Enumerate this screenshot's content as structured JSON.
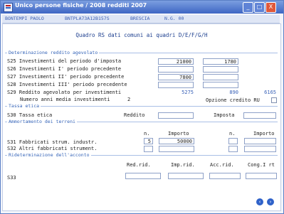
{
  "window": {
    "title": "Unico persone fisiche / 2008 redditi 2007",
    "minimize_label": "_",
    "maximize_label": "□",
    "close_label": "X"
  },
  "infobar": {
    "name": "BONTEMPI PAOLO",
    "code": "BNTPLA73A12B157S",
    "city": "BRESCIA",
    "ref": "N.G. 00"
  },
  "panel": {
    "title": "Quadro RS dati comuni ai quadri D/E/F/G/H"
  },
  "section_reddito": {
    "legend": "Determinazione reddito agevolato",
    "rows": [
      {
        "label": "S25 Investimenti del periodo d'imposta",
        "v1": "21000",
        "v2": "1780"
      },
      {
        "label": "S26 Investimenti I' periodo precedente",
        "v1": "",
        "v2": ""
      },
      {
        "label": "S27 Investimenti II' periodo precedente",
        "v1": "7800",
        "v2": ""
      },
      {
        "label": "S28 Investimenti III' periodo precedente",
        "v1": "",
        "v2": ""
      },
      {
        "label": "S29 Reddito agevolato per investimenti",
        "v1": "5275",
        "v2": "890",
        "v3": "6165"
      }
    ],
    "media_label": "Numero anni media investimenti",
    "media_value": "2",
    "opzione_label": "Opzione credito RU"
  },
  "section_tassa": {
    "legend": "Tassa etica",
    "row_label": "S30 Tassa etica",
    "reddito_label": "Reddito",
    "imposta_label": "Imposta"
  },
  "section_ammortamento": {
    "legend": "Ammortamento dei terreni",
    "col_n": "n.",
    "col_importo": "Importo",
    "row1_label": "S31 Fabbricati strum. industr.",
    "row1_n": "5",
    "row1_importo": "50000",
    "row2_label": "S32 Altri fabbricati strument."
  },
  "section_acconto": {
    "legend": "Rideterminazione dell'acconto",
    "col1": "Red.rid.",
    "col2": "Imp.rid.",
    "col3": "Acc.rid.",
    "col4": "Cong.I rt",
    "row_label": "S33"
  },
  "nav": {
    "prev": "‹",
    "next": "›"
  },
  "colors": {
    "titlebar": "#3e66c4",
    "accent": "#3564b8",
    "close": "#e0583a"
  }
}
